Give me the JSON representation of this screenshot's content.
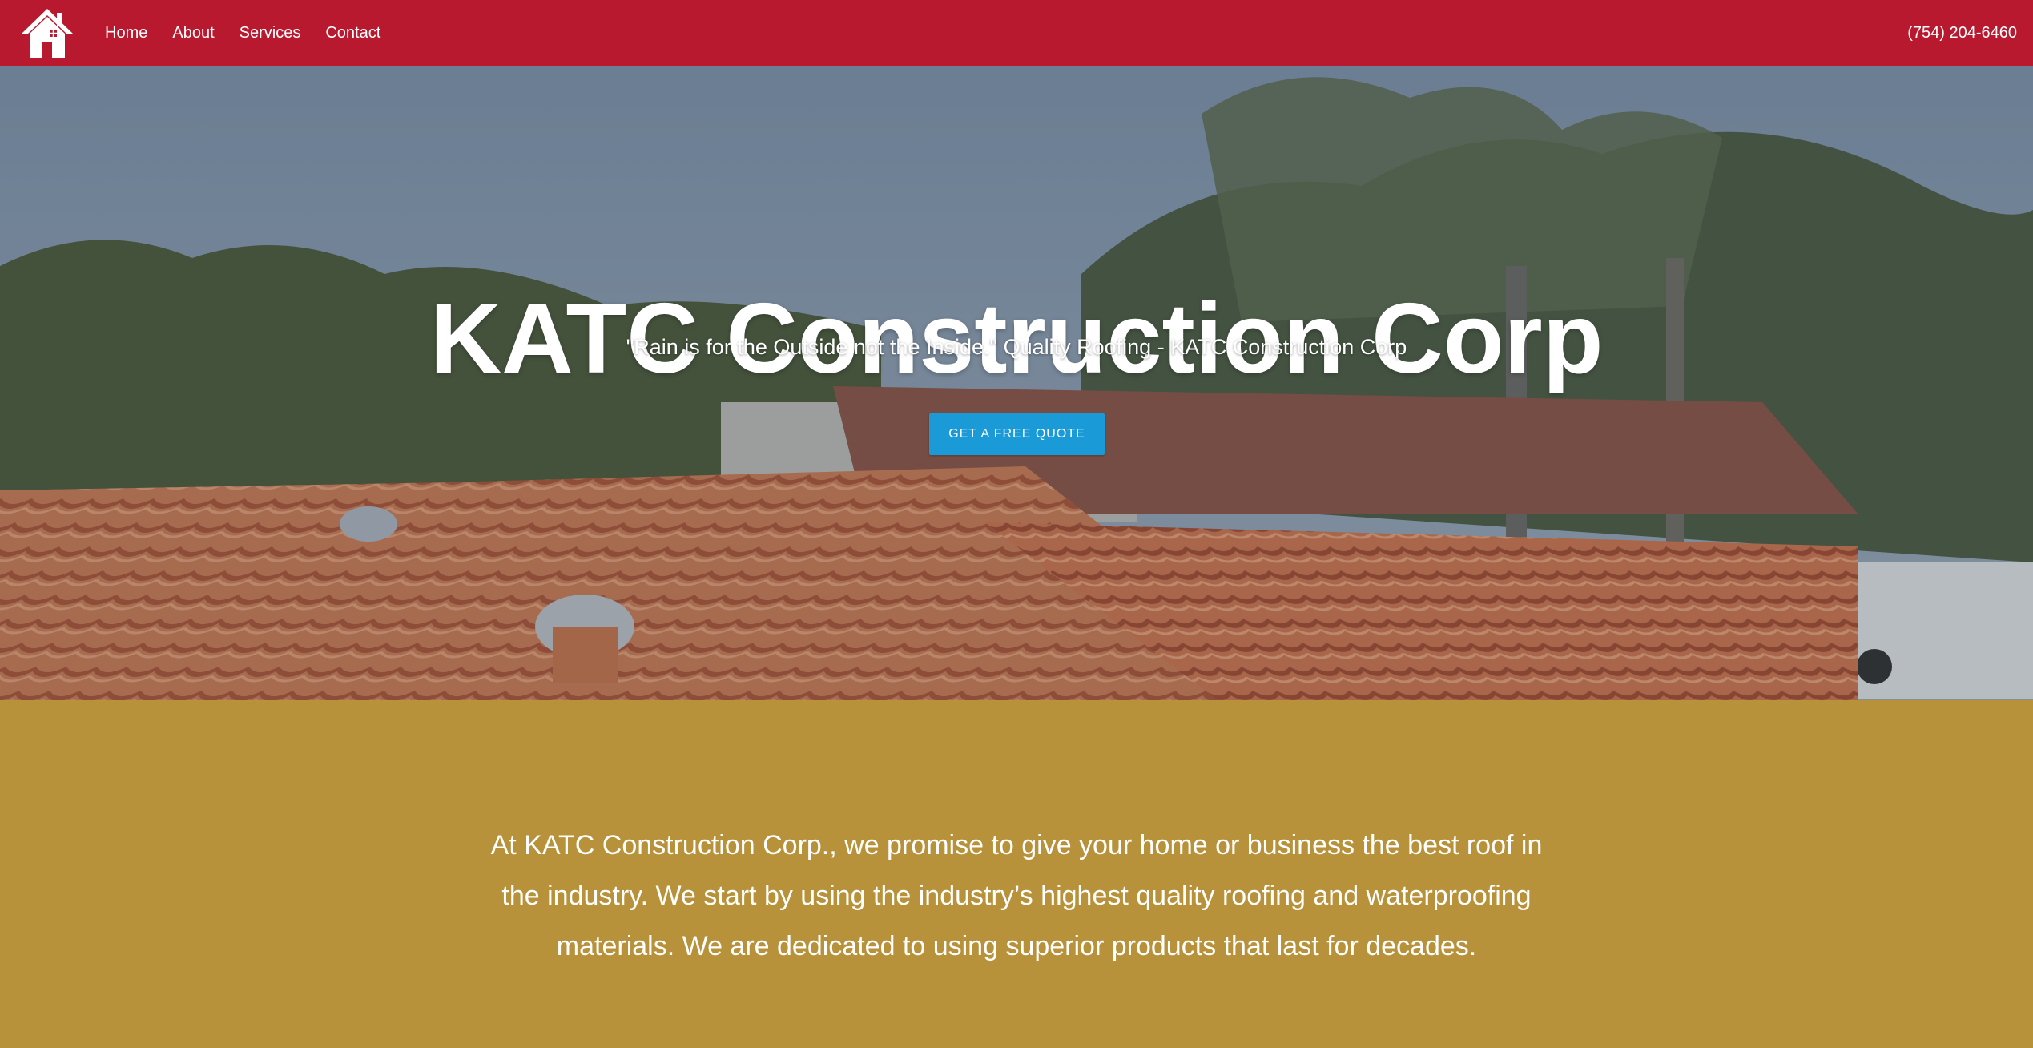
{
  "brand": {
    "logo_icon": "house-icon",
    "color": "#b8192e"
  },
  "nav": {
    "items": [
      {
        "label": "Home"
      },
      {
        "label": "About"
      },
      {
        "label": "Services"
      },
      {
        "label": "Contact"
      }
    ]
  },
  "header": {
    "phone": "(754) 204-6460"
  },
  "hero": {
    "title": "KATC Construction Corp",
    "subtitle": "\"Rain is for the Outside not the Inside.\" Quality Roofing - KATC Construction Corp",
    "cta_label": "GET A FREE QUOTE",
    "cta_color": "#1a9ad6"
  },
  "promise": {
    "text": "At KATC Construction Corp., we promise to give your home or business the best roof in the industry.  We start by using the industry’s highest quality roofing and waterproofing materials.  We are dedicated to using superior products that last for decades.",
    "background": "#b8923a"
  }
}
